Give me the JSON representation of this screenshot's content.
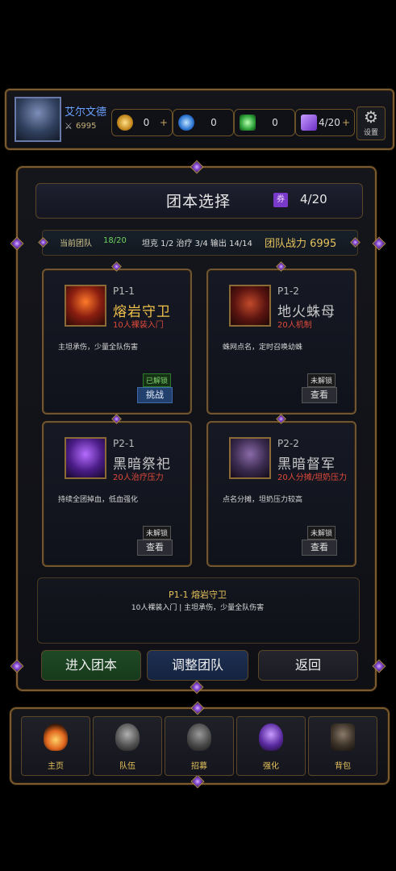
{
  "player": {
    "name": "艾尔文德",
    "power": "6995"
  },
  "resources": {
    "gold": {
      "value": "0",
      "plus": "+"
    },
    "gem": {
      "value": "0"
    },
    "emerald": {
      "value": "0"
    },
    "ticket": {
      "value": "4/20",
      "plus": "+"
    }
  },
  "settings_label": "设置",
  "header": {
    "title": "团本选择",
    "ticket_badge": "券",
    "ticket_count": "4/20"
  },
  "team_info": {
    "label": "当前团队",
    "count": "18/20",
    "roles": "坦克 1/2  治疗 3/4  输出 14/14",
    "power": "团队战力 6995"
  },
  "raids": [
    {
      "code": "P1-1",
      "name": "熔岩守卫",
      "sub": "10人裸装入门",
      "desc": "主坦承伤，少量全队伤害",
      "status": "已解锁",
      "action": "挑战",
      "name_color": "#f0c24a"
    },
    {
      "code": "P1-2",
      "name": "地火蛛母",
      "sub": "20人机制",
      "desc": "蛛网点名，定时召唤幼蛛",
      "status": "未解锁",
      "action": "查看",
      "name_color": "#c8c8c8"
    },
    {
      "code": "P2-1",
      "name": "黑暗祭祀",
      "sub": "20人治疗压力",
      "desc": "持续全团掉血，低血强化",
      "status": "未解锁",
      "action": "查看",
      "name_color": "#c8c8c8"
    },
    {
      "code": "P2-2",
      "name": "黑暗督军",
      "sub": "20人分摊/坦奶压力",
      "desc": "点名分摊，坦奶压力较高",
      "status": "未解锁",
      "action": "查看",
      "name_color": "#c8c8c8"
    }
  ],
  "detail": {
    "title": "P1-1 熔岩守卫",
    "text": "10人裸装入门 | 主坦承伤，少量全队伤害"
  },
  "actions": {
    "enter": "进入团本",
    "adjust": "调整团队",
    "back": "返回"
  },
  "nav": [
    {
      "label": "主页",
      "icon": "campfire-icon"
    },
    {
      "label": "队伍",
      "icon": "helmet-icon"
    },
    {
      "label": "招募",
      "icon": "knight-helmet-icon"
    },
    {
      "label": "强化",
      "icon": "wizard-icon"
    },
    {
      "label": "背包",
      "icon": "backpack-icon"
    }
  ],
  "colors": {
    "gold": "#e6c25c",
    "unlocked": "#7ed36a",
    "danger": "#e04a3b",
    "accent_blue": "#6aa0ff"
  }
}
